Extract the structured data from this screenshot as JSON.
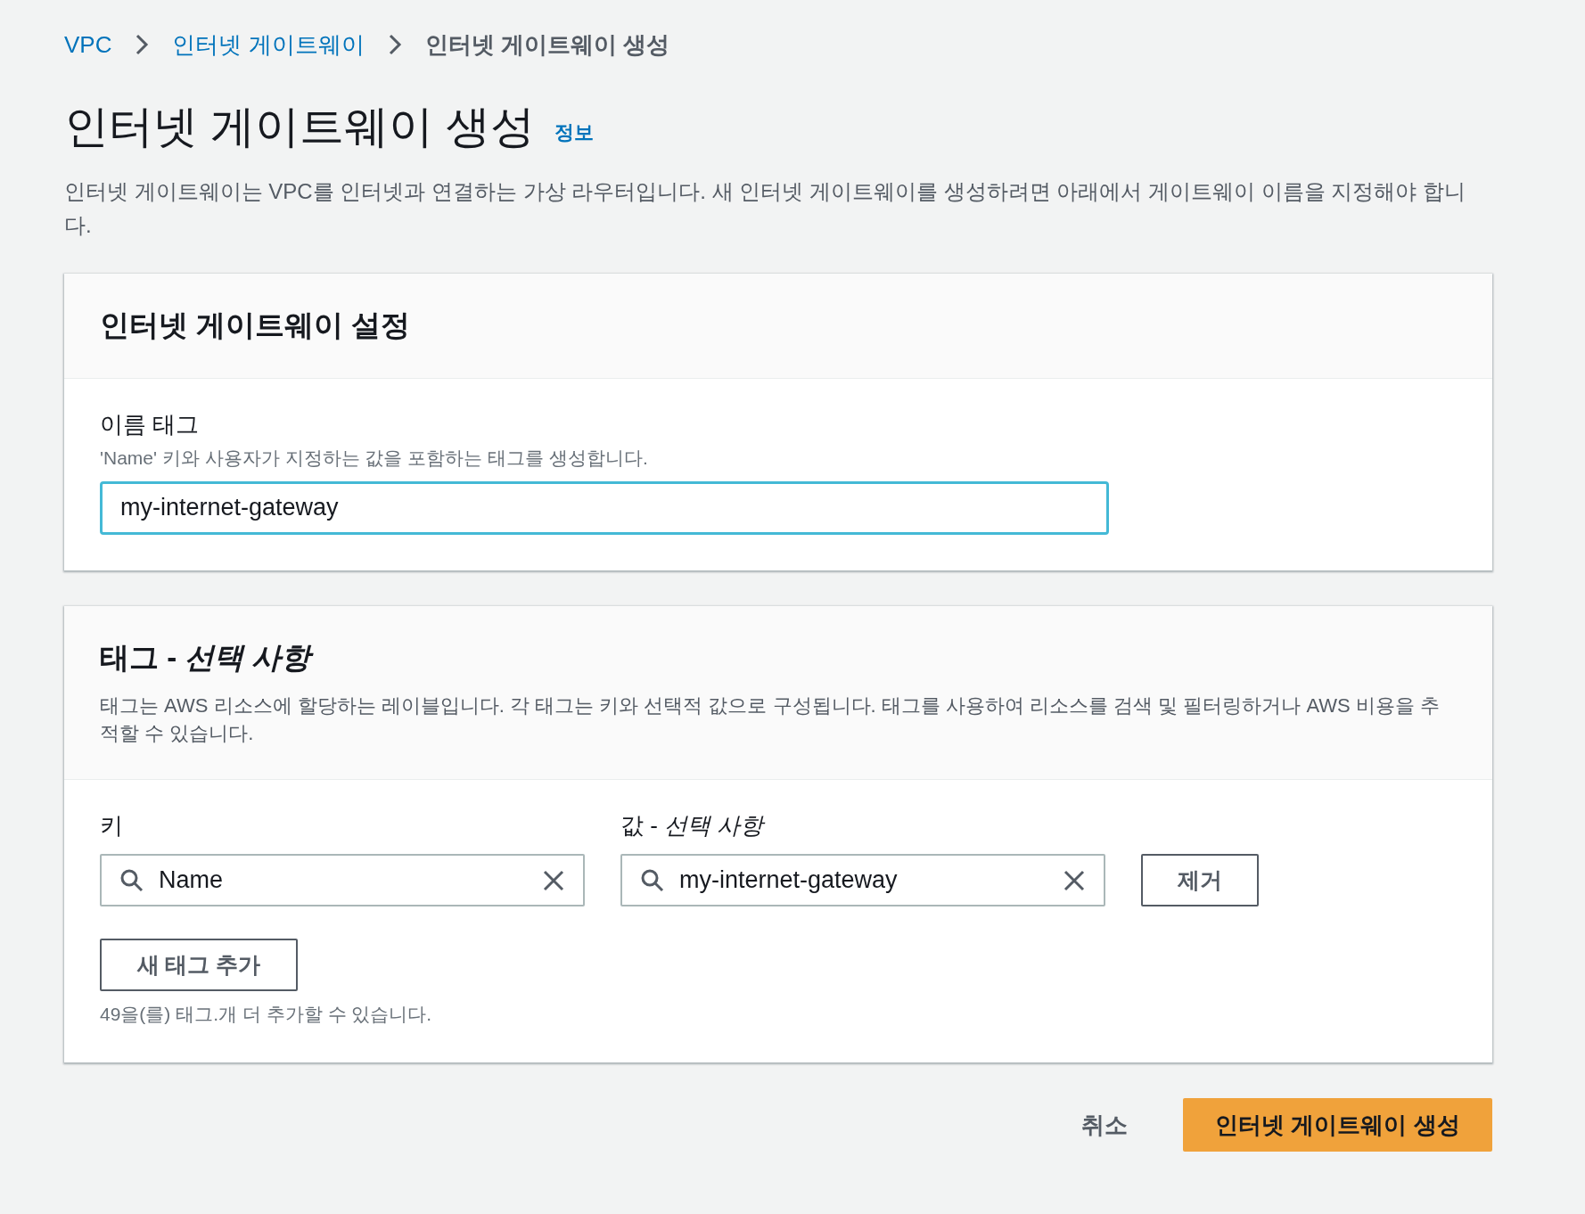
{
  "breadcrumb": [
    {
      "label": "VPC",
      "kind": "link"
    },
    {
      "label": "인터넷 게이트웨이",
      "kind": "link"
    },
    {
      "label": "인터넷 게이트웨이 생성",
      "kind": "current"
    }
  ],
  "page": {
    "title": "인터넷 게이트웨이 생성",
    "info_link": "정보",
    "description": "인터넷 게이트웨이는 VPC를 인터넷과 연결하는 가상 라우터입니다. 새 인터넷 게이트웨이를 생성하려면 아래에서 게이트웨이 이름을 지정해야 합니다."
  },
  "settings_panel": {
    "title": "인터넷 게이트웨이 설정",
    "field": {
      "label": "이름 태그",
      "hint": "'Name' 키와 사용자가 지정하는 값을 포함하는 태그를 생성합니다.",
      "value": "my-internet-gateway",
      "focused": true
    }
  },
  "tags_panel": {
    "title": "태그 - *선택 사항*",
    "description": "태그는 AWS 리소스에 할당하는 레이블입니다. 각 태그는 키와 선택적 값으로 구성됩니다. 태그를 사용하여 리소스를 검색 및 필터링하거나 AWS 비용을 추적할 수 있습니다.",
    "key_label": "키",
    "value_label": "값 - *선택 사항*",
    "tags": [
      {
        "key": "Name",
        "value": "my-internet-gateway",
        "remove_button": "제거"
      }
    ],
    "add_button": "새 태그 추가",
    "limit_note": "49을(를) 태그.개 더 추가할 수 있습니다."
  },
  "actions": {
    "cancel": "취소",
    "submit": "인터넷 게이트웨이 생성"
  }
}
